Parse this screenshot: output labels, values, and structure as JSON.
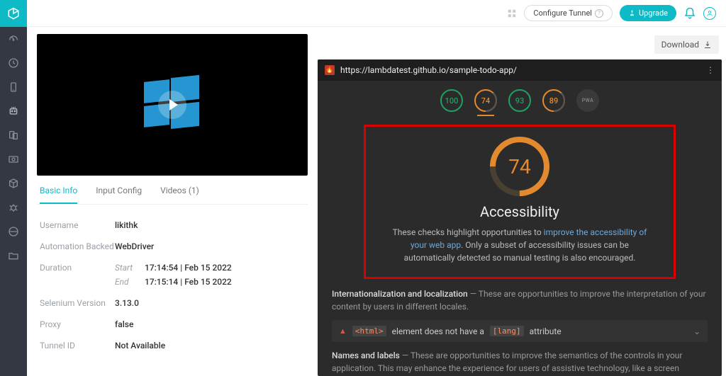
{
  "topbar": {
    "configure_tunnel": "Configure Tunnel",
    "upgrade": "Upgrade"
  },
  "tabs": {
    "basic_info": "Basic Info",
    "input_config": "Input Config",
    "videos": "Videos (1)"
  },
  "info": {
    "username_label": "Username",
    "username_value": "likithk",
    "automation_label": "Automation Backed",
    "automation_value": "WebDriver",
    "duration_label": "Duration",
    "start_label": "Start",
    "start_value": "17:14:54 | Feb 15 2022",
    "end_label": "End",
    "end_value": "17:15:14 | Feb 15 2022",
    "selenium_label": "Selenium Version",
    "selenium_value": "3.13.0",
    "proxy_label": "Proxy",
    "proxy_value": "false",
    "tunnel_label": "Tunnel ID",
    "tunnel_value": "Not Available"
  },
  "download_label": "Download",
  "report": {
    "url": "https://lambdatest.github.io/sample-todo-app/",
    "gauges": {
      "perf": "100",
      "a11y": "74",
      "bp": "93",
      "seo": "89",
      "pwa": "PWA"
    },
    "a11y": {
      "score": "74",
      "title": "Accessibility",
      "text_pre": "These checks highlight opportunities to ",
      "link": "improve the accessibility of your web app",
      "text_post": ". Only a subset of accessibility issues can be automatically detected so manual testing is also encouraged."
    },
    "i18n": {
      "title": "Internationalization and localization",
      "desc": " — These are opportunities to improve the interpretation of your content by users in different locales.",
      "audit_pre": " element does not have a ",
      "audit_code1": "<html>",
      "audit_code2": "[lang]",
      "audit_post": " attribute"
    },
    "names": {
      "title": "Names and labels",
      "desc": " — These are opportunities to improve the semantics of the controls in your application. This may enhance the experience for users of assistive technology, like a screen"
    }
  }
}
